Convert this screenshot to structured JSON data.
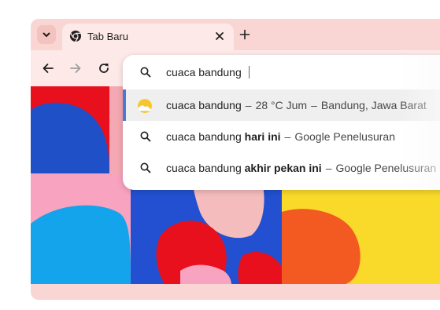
{
  "tab": {
    "title": "Tab Baru"
  },
  "omnibox": {
    "query": "cuaca bandung"
  },
  "suggestions": [
    {
      "main": "cuaca bandung",
      "bold": "",
      "extra1": "28 °C Jum",
      "extra2": "Bandung, Jawa Barat",
      "icon": "weather-sunny-icon"
    },
    {
      "main": "cuaca bandung ",
      "bold": "hari ini",
      "extra1": "Google Penelusuran",
      "icon": "search-icon"
    },
    {
      "main": "cuaca bandung ",
      "bold": "akhir pekan ini",
      "extra1": "Google Penelusuran",
      "icon": "search-icon"
    }
  ],
  "separator": "–",
  "colors": {
    "accent": "#4a78d6",
    "window": "#f9d6d4",
    "tab": "#fde9e7"
  }
}
